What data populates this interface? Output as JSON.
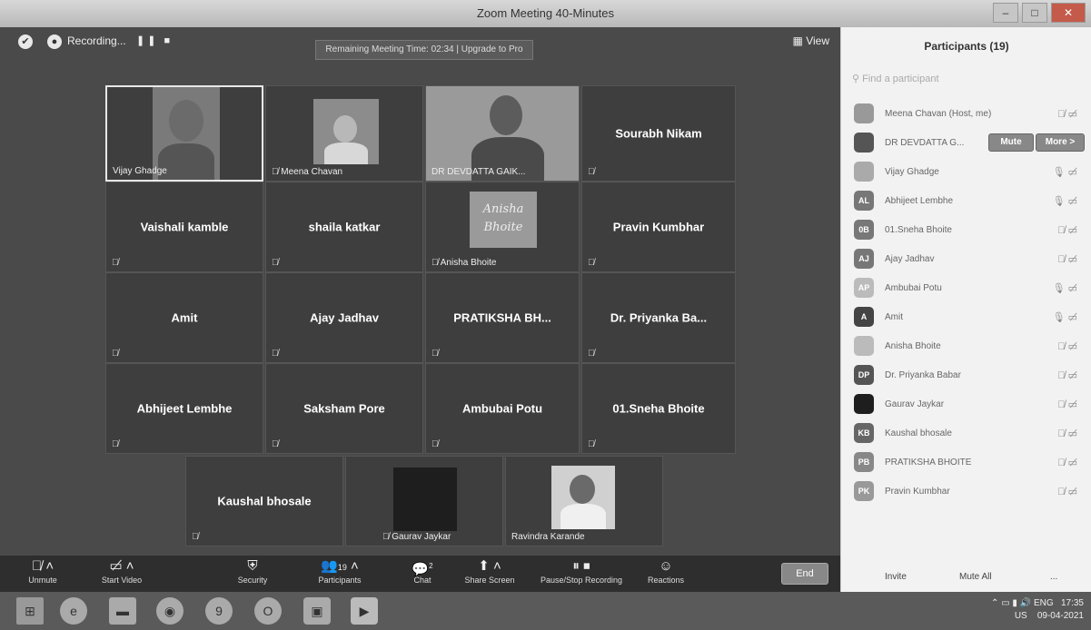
{
  "window": {
    "title": "Zoom Meeting 40-Minutes",
    "min": "–",
    "max": "□",
    "close": "✕"
  },
  "topbar": {
    "recording_label": "Recording...",
    "recording_controls": "❚❚ ■",
    "remaining_text": "Remaining Meeting Time: 02:34 | Upgrade to Pro",
    "view_label": "View"
  },
  "tiles": {
    "vijay": "Vijay Ghadge",
    "meena": "Meena Chavan",
    "devdatta": "DR DEVDATTA GAIK...",
    "sourabh": "Sourabh Nikam",
    "vaishali": "Vaishali kamble",
    "shaila": "shaila katkar",
    "anisha_art": "Anisha Bhoite",
    "anisha": "Anisha Bhoite",
    "pravin": "Pravin Kumbhar",
    "amit": "Amit",
    "ajay": "Ajay Jadhav",
    "pratiksha": "PRATIKSHA BH...",
    "priyanka": "Dr. Priyanka Ba...",
    "abhijeet": "Abhijeet Lembhe",
    "saksham": "Saksham  Pore",
    "ambubai": "Ambubai Potu",
    "sneha": "01.Sneha Bhoite",
    "kaushal": "Kaushal bhosale",
    "gaurav": "Gaurav Jaykar",
    "ravindra": "Ravindra Karande"
  },
  "toolbar": {
    "unmute": "Unmute",
    "start_video": "Start Video",
    "security": "Security",
    "participants": "Participants",
    "participants_count": "19",
    "chat": "Chat",
    "chat_badge": "2",
    "share_screen": "Share Screen",
    "pause_stop": "Pause/Stop Recording",
    "reactions": "Reactions",
    "end": "End"
  },
  "panel": {
    "title": "Participants (19)",
    "search_placeholder": "Find a participant",
    "mute_label": "Mute",
    "more_label": "More >",
    "invite": "Invite",
    "mute_all": "Mute All",
    "more_dots": "...",
    "participants": [
      {
        "initials": "",
        "name": "Meena Chavan (Host, me)"
      },
      {
        "initials": "",
        "name": "DR DEVDATTA G..."
      },
      {
        "initials": "",
        "name": "Vijay Ghadge"
      },
      {
        "initials": "AL",
        "name": "Abhijeet Lembhe"
      },
      {
        "initials": "0B",
        "name": "01.Sneha Bhoite"
      },
      {
        "initials": "AJ",
        "name": "Ajay Jadhav"
      },
      {
        "initials": "AP",
        "name": "Ambubai Potu"
      },
      {
        "initials": "A",
        "name": "Amit"
      },
      {
        "initials": "",
        "name": "Anisha Bhoite"
      },
      {
        "initials": "DP",
        "name": "Dr. Priyanka Babar"
      },
      {
        "initials": "",
        "name": "Gaurav Jaykar"
      },
      {
        "initials": "KB",
        "name": "Kaushal bhosale"
      },
      {
        "initials": "PB",
        "name": "PRATIKSHA BHOITE"
      },
      {
        "initials": "PK",
        "name": "Pravin Kumbhar"
      }
    ]
  },
  "taskbar": {
    "lang": "ENG",
    "region": "US",
    "time": "17:35",
    "date": "09-04-2021"
  }
}
